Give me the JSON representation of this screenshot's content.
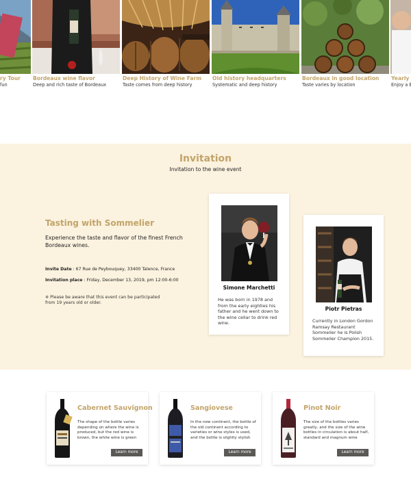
{
  "carousel": {
    "slides": [
      {
        "title": "ry Tour",
        "subtitle": "fun"
      },
      {
        "title": "Bordeaux wine flavor",
        "subtitle": "Deep and rich taste of Bordeaux"
      },
      {
        "title": "Deep History of Wine Farm",
        "subtitle": "Taste comes from deep history"
      },
      {
        "title": "Old history headquarters",
        "subtitle": "Systematic and deep history"
      },
      {
        "title": "Bordeaux in good location",
        "subtitle": "Taste varies by location"
      },
      {
        "title": "Yearly W",
        "subtitle": "Enjoy a B"
      }
    ]
  },
  "invitation": {
    "title": "Invitation",
    "subtitle": "Invitation to the wine event",
    "tasting": {
      "title": "Tasting with Sommelier",
      "description": "Experience the taste and flavor of the finest French Bordeaux wines.",
      "date_label": "Invite Date",
      "date_value": " : 67 Rue de Peybouquey, 33400 Talence, France",
      "place_label": "Invitation place",
      "place_value": " : Friday, December 13, 2019, pm 12:00-6:00",
      "note": "※ Please be aware that this event can be participated from 19 years old or older."
    },
    "sommeliers": [
      {
        "name": "Simone Marchetti",
        "bio": "He was born in 1978 and from the early eighties his father and he went down to the wine cellar to drink red wine."
      },
      {
        "name": "Piotr Pietras",
        "bio": "Currently in London Gordon Ramsay Restaurant Sommelier he is Polish Sommelier Champion 2015."
      }
    ]
  },
  "wines": [
    {
      "title": "Cabernet Sauvignon",
      "description": "The shape of the bottle varies depending on where the wine is produced, but the red wine is brown, the white wine is green",
      "button": "Learn more"
    },
    {
      "title": "Sangiovese",
      "description": "In the new continent, the bottle of the old continent according to varieties or wine styles is used, and the bottle is slightly stylish",
      "button": "Learn more"
    },
    {
      "title": "Pinot Noir",
      "description": "The size of the bottles varies greatly, and the size of the wine bottles in circulation is about half, standard and magnum wine",
      "button": "Learn more"
    }
  ]
}
